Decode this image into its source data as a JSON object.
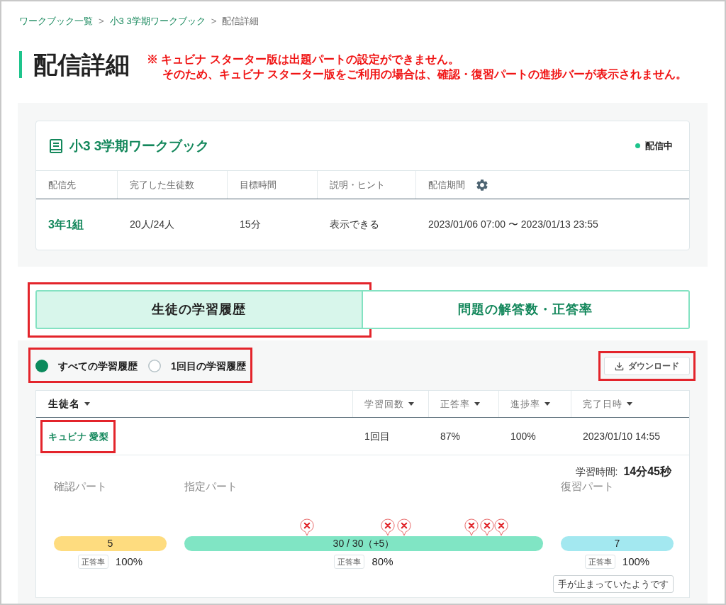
{
  "breadcrumb": [
    {
      "kind": "link",
      "label": "ワークブック一覧",
      "separator": ">"
    },
    {
      "kind": "link",
      "label": "小3 3学期ワークブック",
      "separator": ">"
    },
    {
      "kind": "current",
      "label": "配信詳細"
    }
  ],
  "page_title": "配信詳細",
  "notice": [
    "※ キュビナ スターター版は出題パートの設定ができません。",
    "そのため、キュビナ スターター版をご利用の場合は、確認・復習パートの進捗バーが表示されません。"
  ],
  "card": {
    "title": "小3 3学期ワークブック",
    "status": "配信中",
    "columns": [
      "配信先",
      "完了した生徒数",
      "目標時間",
      "説明・ヒント",
      "配信期間"
    ],
    "row": [
      "3年1組",
      "20人/24人",
      "15分",
      "表示できる",
      "2023/01/06 07:00 〜 2023/01/13 23:55"
    ]
  },
  "tabs": [
    {
      "label": "生徒の学習履歴",
      "selected": true,
      "highlighted": true
    },
    {
      "label": "問題の解答数・正答率",
      "selected": false,
      "highlighted": false
    }
  ],
  "filter": {
    "highlighted": true,
    "options": [
      {
        "label": "すべての学習履歴",
        "selected": true
      },
      {
        "label": "1回目の学習履歴",
        "selected": false
      }
    ]
  },
  "download": {
    "label": "ダウンロード",
    "highlighted": true
  },
  "table": {
    "columns": [
      "生徒名",
      "学習回数",
      "正答率",
      "進捗率",
      "完了日時"
    ],
    "rows": [
      {
        "cells": [
          "キュビナ 愛梨",
          "1回目",
          "87%",
          "100%",
          "2023/01/10 14:55"
        ],
        "highlighted": true,
        "expanded": true,
        "detail": {
          "study_time_label": "学習時間:",
          "study_time": "14分45秒",
          "parts": [
            {
              "label": "確認パート",
              "color": "#fedc7f",
              "count": "5",
              "rate_label": "正答率",
              "rate": "100%"
            },
            {
              "label": "指定パート",
              "color": "#80e5c4",
              "count": "30 / 30（+5）",
              "rate_label": "正答率",
              "rate": "80%",
              "markers": [
                {
                  "level": 0.341
                },
                {
                  "level": 0.568
                },
                {
                  "level": 0.613
                },
                {
                  "level": 0.801
                },
                {
                  "level": 0.843
                },
                {
                  "level": 0.884
                }
              ]
            },
            {
              "label": "復習パート",
              "color": "#a3e8f0",
              "count": "7",
              "rate_label": "正答率",
              "rate": "100%",
              "note": "手が止まっていたようです"
            }
          ]
        }
      }
    ]
  }
}
